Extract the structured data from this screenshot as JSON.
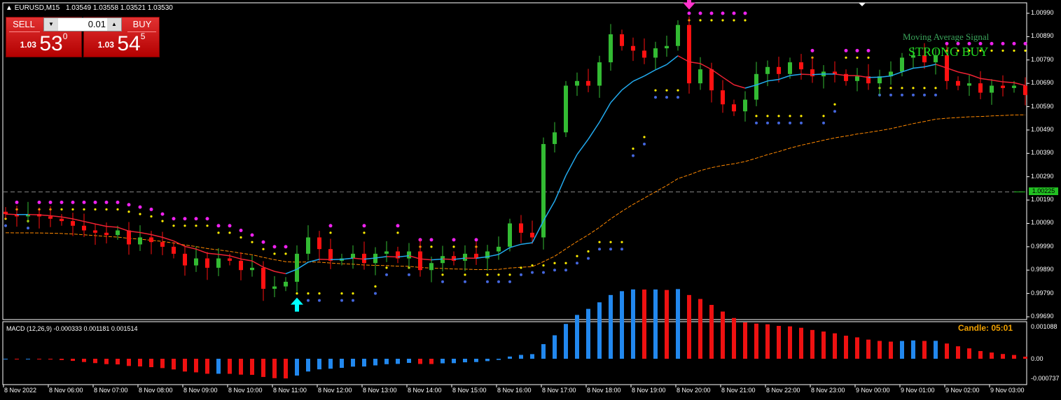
{
  "header": {
    "symbol": "EURUSD,M15",
    "values": "1.03549 1.03558 1.03521 1.03530"
  },
  "trade_panel": {
    "sell_label": "SELL",
    "buy_label": "BUY",
    "lot": "0.01",
    "sell_price": {
      "prefix": "1.03",
      "main": "53",
      "sup": "0"
    },
    "buy_price": {
      "prefix": "1.03",
      "main": "54",
      "sup": "5"
    }
  },
  "signal": {
    "title": "Moving Average Signal",
    "value": "STRONG BUY"
  },
  "current_price_tag": "1.00225",
  "macd": {
    "label": "MACD (12,26,9) -0.000333 0.001181 0.001514",
    "axis": [
      "0.001088",
      "0.00",
      "-0.000737"
    ]
  },
  "candle_timer": "Candle:  05:01",
  "colors": {
    "bull": "#33bb33",
    "bear": "#ff1111",
    "ma_up": "#22aaee",
    "ma_down": "#ee2233",
    "slow_ma": "#ff8800",
    "macd_up": "#2288ee",
    "macd_down": "#ee1111"
  },
  "chart_data": {
    "type": "candlestick",
    "title": "EURUSD,M15",
    "ylim": [
      0.9969,
      1.0099
    ],
    "price_ticks": [
      "1.00990",
      "1.00890",
      "1.00790",
      "1.00690",
      "1.00590",
      "1.00490",
      "1.00390",
      "1.00290",
      "1.00190",
      "1.00090",
      "0.99990",
      "0.99890",
      "0.99790",
      "0.99690"
    ],
    "time_ticks": [
      "8 Nov 2022",
      "8 Nov 06:00",
      "8 Nov 07:00",
      "8 Nov 08:00",
      "8 Nov 09:00",
      "8 Nov 10:00",
      "8 Nov 11:00",
      "8 Nov 12:00",
      "8 Nov 13:00",
      "8 Nov 14:00",
      "8 Nov 15:00",
      "8 Nov 16:00",
      "8 Nov 17:00",
      "8 Nov 18:00",
      "8 Nov 19:00",
      "8 Nov 20:00",
      "8 Nov 21:00",
      "8 Nov 22:00",
      "8 Nov 23:00",
      "9 Nov 00:00",
      "9 Nov 01:00",
      "9 Nov 02:00",
      "9 Nov 03:00"
    ],
    "horizontal_line": 1.00225,
    "arrows": [
      {
        "type": "buy",
        "bar": 26
      },
      {
        "type": "sell",
        "bar": 61
      }
    ],
    "closes": [
      1.0013,
      1.0012,
      1.0013,
      1.0012,
      1.0011,
      1.001,
      1.0008,
      1.0006,
      1.0005,
      1.0004,
      1.0006,
      1.0,
      1.0003,
      1.0001,
      0.9999,
      0.9996,
      0.9991,
      0.9994,
      0.999,
      0.9994,
      0.9993,
      0.9989,
      0.999,
      0.9981,
      0.9982,
      0.9984,
      0.9996,
      1.0003,
      0.9998,
      0.9993,
      0.9994,
      0.9996,
      0.9992,
      0.9996,
      0.9997,
      0.9994,
      0.9997,
      0.9989,
      0.9992,
      0.9995,
      0.9993,
      0.9996,
      0.9994,
      0.9997,
      0.9999,
      1.0009,
      1.0005,
      1.0003,
      1.0043,
      1.0048,
      1.0068,
      1.007,
      1.0068,
      1.0078,
      1.009,
      1.0085,
      1.0083,
      1.008,
      1.0084,
      1.0085,
      1.0094,
      1.0069,
      1.0075,
      1.0066,
      1.006,
      1.0057,
      1.0062,
      1.0073,
      1.0076,
      1.0073,
      1.0078,
      1.0075,
      1.0072,
      1.0074,
      1.0073,
      1.007,
      1.0072,
      1.0069,
      1.0072,
      1.0074,
      1.008,
      1.0081,
      1.0078,
      1.0081,
      1.007,
      1.0068,
      1.0069,
      1.0065,
      1.0068,
      1.0067,
      1.0068,
      1.0064
    ]
  }
}
